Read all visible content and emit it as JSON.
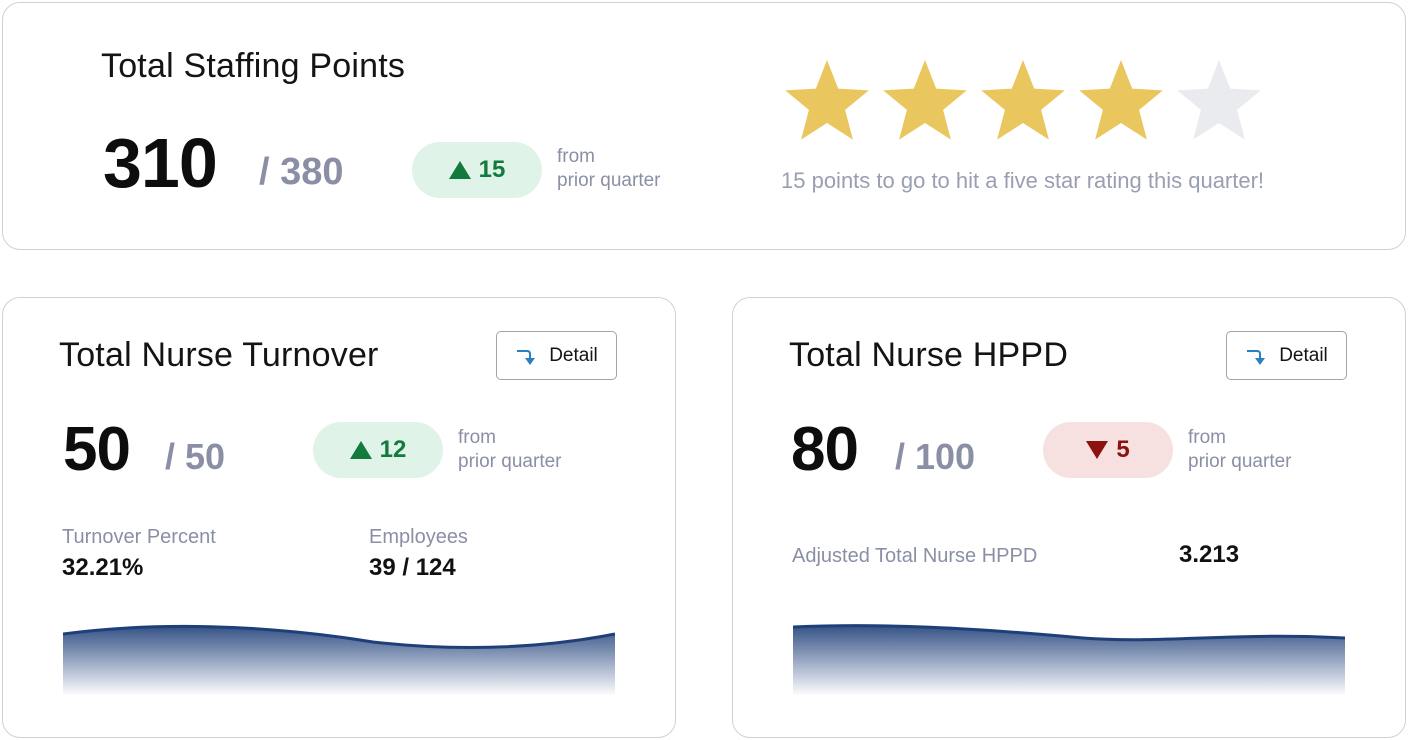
{
  "staffing": {
    "title": "Total Staffing Points",
    "value": "310",
    "total": "/ 380",
    "change": "15",
    "change_direction": "up",
    "from_line1": "from",
    "from_line2": "prior quarter",
    "rating": {
      "filled": 4,
      "max": 5,
      "filled_color": "#e9c75e",
      "empty_color": "#e9ebee"
    },
    "rating_message": "15 points to go to hit a five star rating this quarter!"
  },
  "turnover": {
    "title": "Total Nurse Turnover",
    "detail_label": "Detail",
    "value": "50",
    "total": "/ 50",
    "change": "12",
    "change_direction": "up",
    "from_line1": "from",
    "from_line2": "prior quarter",
    "stats": [
      {
        "label": "Turnover Percent",
        "value": "32.21%"
      },
      {
        "label": "Employees",
        "value": "39 / 124"
      }
    ]
  },
  "hppd": {
    "title": "Total Nurse HPPD",
    "detail_label": "Detail",
    "value": "80",
    "total": "/ 100",
    "change": "5",
    "change_direction": "down",
    "from_line1": "from",
    "from_line2": "prior quarter",
    "stats": [
      {
        "label": "Adjusted Total Nurse HPPD",
        "value": "3.213"
      }
    ]
  },
  "colors": {
    "up": "#137a3e",
    "down": "#8c1111",
    "sparkline": "#1f3f79",
    "detail_icon": "#2a7fc0"
  },
  "icons": {
    "up": "triangle-up-icon",
    "down": "triangle-down-icon",
    "detail": "arrow-turn-down-icon",
    "star": "star-icon"
  }
}
